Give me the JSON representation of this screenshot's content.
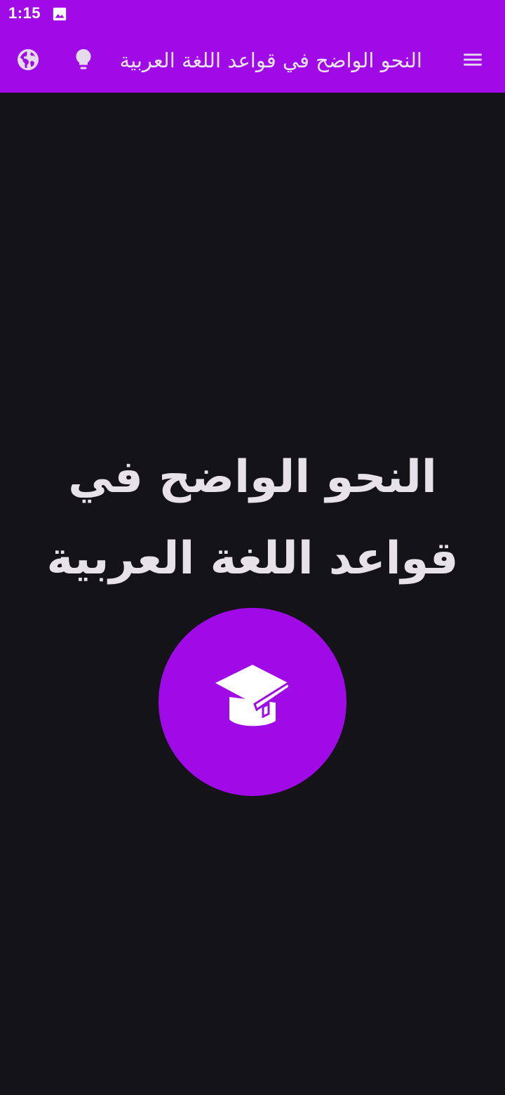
{
  "status_bar": {
    "time": "1:15",
    "notification_icon": "image-icon"
  },
  "app_bar": {
    "title": "النحو الواضح في قواعد اللغة العربية",
    "actions": [
      "globe-icon",
      "lightbulb-icon"
    ],
    "navigation_icon": "menu-icon"
  },
  "main": {
    "headline_line1": "النحو الواضح في",
    "headline_line2": "قواعد اللغة العربية",
    "button_icon": "graduation-cap-book-icon"
  },
  "colors": {
    "primary": "#9f0ae6",
    "background": "#141318",
    "on_background": "#e7e1ea",
    "on_primary": "#ffffff"
  }
}
